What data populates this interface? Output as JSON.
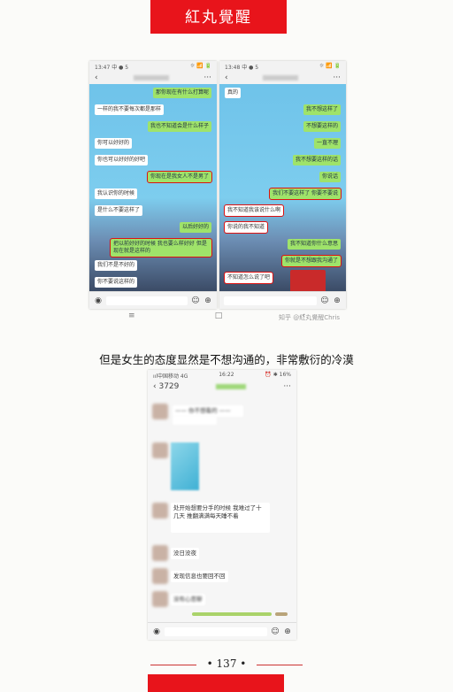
{
  "header": {
    "title": "紅丸覺醒"
  },
  "left_screen": {
    "status_time": "13:47",
    "status_left": "13:47 中 ● 5",
    "status_right": "☼ 📶 🔋",
    "back_icon": "back-chevron-icon",
    "more_icon": "more-dots-icon",
    "messages": [
      {
        "side": "right",
        "text": "那你现在有什么打算呢",
        "hl": false
      },
      {
        "side": "left",
        "text": "一样的我不要每次都是那样",
        "hl": false
      },
      {
        "side": "right",
        "text": "我也不知道会是什么样子",
        "hl": false
      },
      {
        "side": "left",
        "text": "你可以好好的",
        "hl": false
      },
      {
        "side": "left",
        "text": "你也可以好好的好吧",
        "hl": false
      },
      {
        "side": "right",
        "text": "你现在是我女人不是男了",
        "hl": true
      },
      {
        "side": "left",
        "text": "我认识你的时候",
        "hl": false
      },
      {
        "side": "left",
        "text": "是什么不要这样了",
        "hl": false
      },
      {
        "side": "right",
        "text": "以后好好的",
        "hl": false
      },
      {
        "side": "right",
        "text": "把以前好好的时候 我也要么样好好 但是 现在就是这样的",
        "hl": true
      },
      {
        "side": "left",
        "text": "我们不是不好的",
        "hl": false
      },
      {
        "side": "left",
        "text": "你不要说这样的",
        "hl": false
      }
    ]
  },
  "right_screen": {
    "status_left": "13:48 中 ● 5",
    "status_right": "☼ 📶 🔋",
    "messages": [
      {
        "side": "left",
        "text": "真的",
        "hl": false
      },
      {
        "side": "right",
        "text": "我不想这样了",
        "hl": false
      },
      {
        "side": "right",
        "text": "不想要这样的",
        "hl": false
      },
      {
        "side": "right",
        "text": "一直不理",
        "hl": false
      },
      {
        "side": "right",
        "text": "我不想要这样的话",
        "hl": false
      },
      {
        "side": "right",
        "text": "你说话",
        "hl": false
      },
      {
        "side": "right",
        "text": "我们不要这样了 你要不要说",
        "hl": true
      },
      {
        "side": "left",
        "text": "我不知道我该说什么啊",
        "hl": true
      },
      {
        "side": "left",
        "text": "你说的我不知道",
        "hl": true
      },
      {
        "side": "right",
        "text": "我不知道你什么意思",
        "hl": false
      },
      {
        "side": "right",
        "text": "你就是不想跟我沟通了",
        "hl": true
      },
      {
        "side": "left",
        "text": "不知道怎么说了吧",
        "hl": true
      }
    ]
  },
  "sysnav": {
    "menu": "≡",
    "home": "□",
    "back": "‹"
  },
  "watermark": "知乎 @紅丸覺醒Chris",
  "caption": "但是女生的态度显然是不想沟通的，非常敷衍的冷漠",
  "bottom_screen": {
    "status_left": "ııl中国移动 4G",
    "status_time": "16:22",
    "status_right": "⏰ ✱ 16%",
    "back_label": "3729",
    "messages": [
      {
        "text": "—— 你不想看的 ——"
      },
      {
        "text": "处开始想要分手的时候 我难过了十几天 推翻满满每天睡不着"
      },
      {
        "text": "没日没夜"
      },
      {
        "text": "发现信息也要回不回"
      },
      {
        "text": "没有心思聊"
      }
    ]
  },
  "footer": {
    "page_number": "137"
  }
}
